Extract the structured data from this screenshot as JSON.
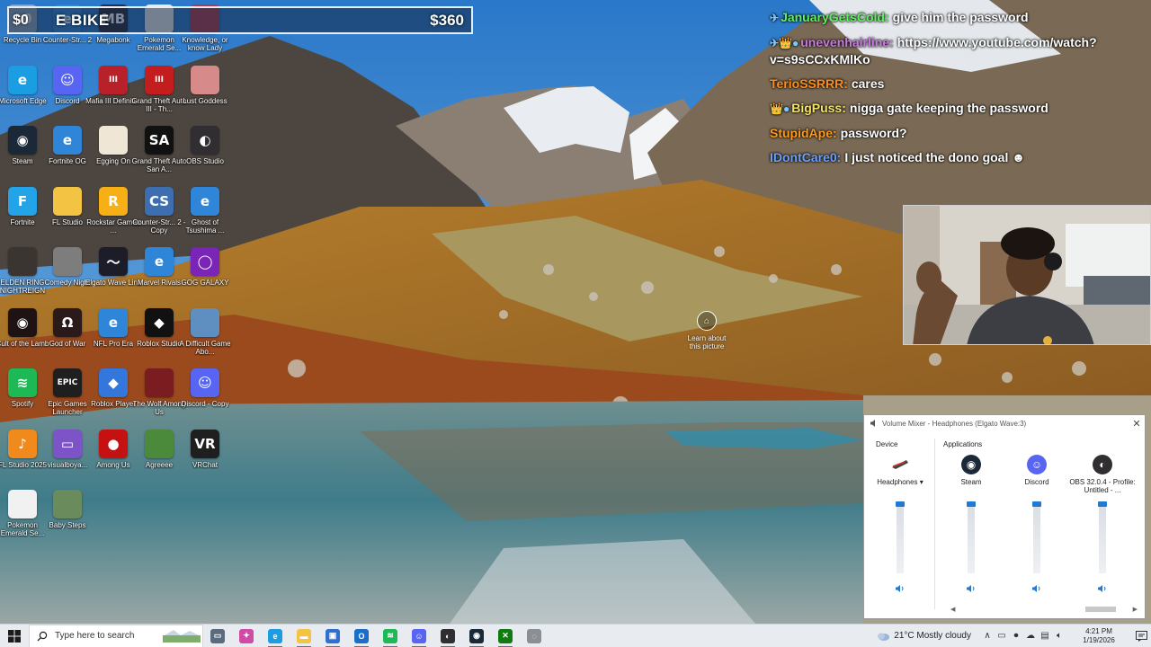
{
  "banner": {
    "left_amount": "$0",
    "title": "E BIKE",
    "right_amount": "$360"
  },
  "desktop_icons": [
    {
      "label": "Recycle Bin",
      "icon": "recycle-bin-icon",
      "color": "#8ea4bd",
      "glyph": "$0"
    },
    {
      "label": "Counter-Str... 2",
      "icon": "internet-explorer-icon",
      "color": "#2f86d8",
      "glyph": "e"
    },
    {
      "label": "Megabonk",
      "icon": "megabonk-icon",
      "color": "#2c2c3a",
      "glyph": "MB"
    },
    {
      "label": "Pokemon Emerald Se...",
      "icon": "document-icon",
      "color": "#e9e9e9",
      "glyph": ""
    },
    {
      "label": "Knowledge, or know Lady",
      "icon": "game-art-icon",
      "color": "#b03a4c",
      "glyph": ""
    },
    {
      "label": "Microsoft Edge",
      "icon": "edge-icon",
      "color": "#1b9de2",
      "glyph": "e"
    },
    {
      "label": "Discord",
      "icon": "discord-icon",
      "color": "#5865f2",
      "glyph": "☺"
    },
    {
      "label": "Mafia III Definiti...",
      "icon": "mafia-icon",
      "color": "#b8202a",
      "glyph": "III"
    },
    {
      "label": "Grand Theft Auto III - Th...",
      "icon": "gta3-icon",
      "color": "#c41d1d",
      "glyph": "III"
    },
    {
      "label": "Lust Goddess",
      "icon": "lust-goddess-icon",
      "color": "#d78a8a",
      "glyph": ""
    },
    {
      "label": "Steam",
      "icon": "steam-icon",
      "color": "#1b2838",
      "glyph": "◉"
    },
    {
      "label": "Fortnite OG",
      "icon": "internet-explorer-icon",
      "color": "#2f86d8",
      "glyph": "e"
    },
    {
      "label": "Egging On",
      "icon": "egg-icon",
      "color": "#efe6d6",
      "glyph": ""
    },
    {
      "label": "Grand Theft Auto San A...",
      "icon": "gta-sa-icon",
      "color": "#111111",
      "glyph": "SA"
    },
    {
      "label": "OBS Studio",
      "icon": "obs-icon",
      "color": "#302e31",
      "glyph": "◐"
    },
    {
      "label": "Fortnite",
      "icon": "fortnite-icon",
      "color": "#23a4e8",
      "glyph": "F"
    },
    {
      "label": "FL Studio",
      "icon": "folder-icon",
      "color": "#f3c443",
      "glyph": ""
    },
    {
      "label": "Rockstar Games ...",
      "icon": "rockstar-icon",
      "color": "#f6b015",
      "glyph": "R"
    },
    {
      "label": "Counter-Str... 2 - Copy",
      "icon": "counter-strike-icon",
      "color": "#3d6fb0",
      "glyph": "CS"
    },
    {
      "label": "Ghost of Tsushima ...",
      "icon": "internet-explorer-icon",
      "color": "#2f86d8",
      "glyph": "e"
    },
    {
      "label": "ELDEN RING NIGHTREIGN",
      "icon": "elden-ring-icon",
      "color": "#3a3530",
      "glyph": ""
    },
    {
      "label": "Comedy Night",
      "icon": "microphone-icon",
      "color": "#7d7d7d",
      "glyph": ""
    },
    {
      "label": "Elgato Wave Link",
      "icon": "elgato-wave-icon",
      "color": "#1d1d2a",
      "glyph": "〜"
    },
    {
      "label": "Marvel Rivals",
      "icon": "internet-explorer-icon",
      "color": "#2f86d8",
      "glyph": "e"
    },
    {
      "label": "GOG GALAXY",
      "icon": "gog-galaxy-icon",
      "color": "#7a25b7",
      "glyph": "◯"
    },
    {
      "label": "Cult of the Lamb",
      "icon": "cult-lamb-icon",
      "color": "#1e1212",
      "glyph": "◉"
    },
    {
      "label": "God of War",
      "icon": "god-of-war-icon",
      "color": "#2a1a1a",
      "glyph": "Ω"
    },
    {
      "label": "NFL Pro Era",
      "icon": "internet-explorer-icon",
      "color": "#2f86d8",
      "glyph": "e"
    },
    {
      "label": "Roblox Studio",
      "icon": "roblox-studio-icon",
      "color": "#111111",
      "glyph": "◆"
    },
    {
      "label": "A Difficult Game Abo...",
      "icon": "game-art-icon",
      "color": "#5f8ec0",
      "glyph": ""
    },
    {
      "label": "Spotify",
      "icon": "spotify-icon",
      "color": "#1db954",
      "glyph": "≋"
    },
    {
      "label": "Epic Games Launcher",
      "icon": "epic-games-icon",
      "color": "#1f1f1f",
      "glyph": "EPIC"
    },
    {
      "label": "Roblox Player",
      "icon": "roblox-icon",
      "color": "#3377dd",
      "glyph": "◆"
    },
    {
      "label": "The Wolf Among Us",
      "icon": "wolf-among-us-icon",
      "color": "#7a1c20",
      "glyph": ""
    },
    {
      "label": "Discord - Copy",
      "icon": "discord-icon",
      "color": "#5865f2",
      "glyph": "☺"
    },
    {
      "label": "FL Studio 2025",
      "icon": "fl-studio-icon",
      "color": "#f08a1c",
      "glyph": "♪"
    },
    {
      "label": "visualboya...",
      "icon": "visualboy-icon",
      "color": "#7d54c8",
      "glyph": "▭"
    },
    {
      "label": "Among Us",
      "icon": "among-us-icon",
      "color": "#c51111",
      "glyph": "●"
    },
    {
      "label": "Agreeee",
      "icon": "minecraft-icon",
      "color": "#4a8a3a",
      "glyph": ""
    },
    {
      "label": "VRChat",
      "icon": "vrchat-icon",
      "color": "#1f1f1f",
      "glyph": "VR"
    },
    {
      "label": "Pokemon Emerald Se...",
      "icon": "document-icon",
      "color": "#f1f1f1",
      "glyph": ""
    },
    {
      "label": "Baby Steps",
      "icon": "baby-steps-icon",
      "color": "#6a8c5c",
      "glyph": ""
    }
  ],
  "chat": [
    {
      "badges": "✈",
      "user": "JanuaryGetsCold:",
      "text": "give him the password",
      "color": "#5ff05f"
    },
    {
      "badges": "✈👑●",
      "user": "unevenhairline:",
      "text": "https://www.youtube.com/watch?v=s9sCCxKMlKo",
      "color": "#c97be0"
    },
    {
      "badges": "",
      "user": "TerioSSRRR:",
      "text": "cares",
      "color": "#ff8c1a"
    },
    {
      "badges": "👑●",
      "user": "BigPuss:",
      "text": "nigga gate keeping the password",
      "color": "#f3e36b"
    },
    {
      "badges": "",
      "user": "StupidApe:",
      "text": "password?",
      "color": "#ff9a1a"
    },
    {
      "badges": "",
      "user": "IDontCare0:",
      "text": "I just noticed the dono goal ☻",
      "color": "#6aa1ff"
    }
  ],
  "learn_picture": {
    "label": "Learn about this picture"
  },
  "volume_mixer": {
    "title": "Volume Mixer - Headphones (Elgato Wave:3)",
    "device_label": "Device",
    "applications_label": "Applications",
    "device": {
      "name": "Headphones",
      "level": 1.0
    },
    "apps": [
      {
        "name": "Steam",
        "level": 1.0,
        "icon": "steam-icon"
      },
      {
        "name": "Discord",
        "level": 1.0,
        "icon": "discord-icon"
      },
      {
        "name": "OBS 32.0.4 - Profile: Untitled - ...",
        "level": 1.0,
        "icon": "obs-icon"
      }
    ]
  },
  "taskbar": {
    "search_placeholder": "Type here to search",
    "apps": [
      {
        "icon": "task-view-icon",
        "color": "#5a6b7d",
        "glyph": "▭"
      },
      {
        "icon": "copilot-icon",
        "color": "#d04ba5",
        "glyph": "✦"
      },
      {
        "icon": "edge-icon",
        "color": "#1b9de2",
        "glyph": "e"
      },
      {
        "icon": "file-explorer-icon",
        "color": "#f3c443",
        "glyph": "▬"
      },
      {
        "icon": "store-icon",
        "color": "#2f6fcf",
        "glyph": "▣"
      },
      {
        "icon": "outlook-icon",
        "color": "#1a6ec7",
        "glyph": "O"
      },
      {
        "icon": "spotify-icon",
        "color": "#1db954",
        "glyph": "≋"
      },
      {
        "icon": "discord-icon",
        "color": "#5865f2",
        "glyph": "☺"
      },
      {
        "icon": "obs-icon",
        "color": "#302e31",
        "glyph": "◐"
      },
      {
        "icon": "steam-icon",
        "color": "#1b2838",
        "glyph": "◉"
      },
      {
        "icon": "xbox-icon",
        "color": "#107c10",
        "glyph": "✕"
      },
      {
        "icon": "settings-app-icon",
        "color": "#8a8f96",
        "glyph": "◌"
      }
    ],
    "weather": "21°C  Mostly cloudy",
    "time": "4:21 PM",
    "date": "1/19/2026"
  }
}
